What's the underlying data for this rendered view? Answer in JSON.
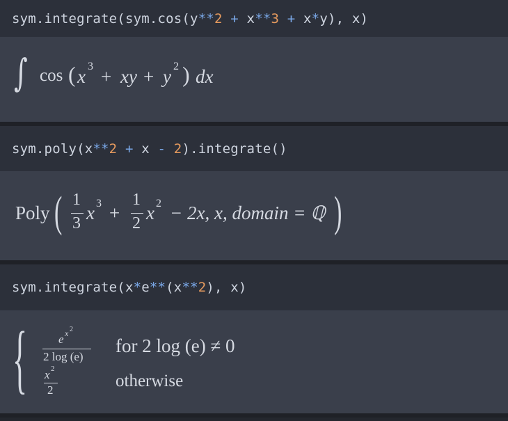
{
  "cells": [
    {
      "code": {
        "prefix": "sym.integrate(sym.cos(y",
        "op1": "**",
        "n1": "2",
        "sp1": " ",
        "plus1": "+",
        "mid1": " x",
        "op2": "**",
        "n2": "3",
        "sp2": " ",
        "plus2": "+",
        "mid2": " x",
        "op3": "*",
        "suffix": "y), x)"
      },
      "output": {
        "integral": "∫",
        "cos": "cos",
        "lparen": "(",
        "x": "x",
        "exp3": "3",
        "plus_a": "+",
        "xy": "xy",
        "plus_b": "+",
        "y": "y",
        "exp2": "2",
        "rparen": ")",
        "dx": "dx"
      }
    },
    {
      "code": {
        "prefix": "sym.poly(x",
        "op1": "**",
        "n1": "2",
        "sp1": " ",
        "plus1": "+",
        "mid1": " x ",
        "minus": "-",
        "sp2": " ",
        "n2": "2",
        "suffix": ").integrate()"
      },
      "output": {
        "poly": "Poly",
        "lparen": "(",
        "num1": "1",
        "den1": "3",
        "x1": "x",
        "exp1": "3",
        "plus": "+",
        "num2": "1",
        "den2": "2",
        "x2": "x",
        "exp2": "2",
        "rest": "− 2x, x, domain = ℚ",
        "rparen": ")"
      }
    },
    {
      "code": {
        "prefix": "sym.integrate(x",
        "op1": "*",
        "mid1": "e",
        "op2": "**",
        "mid2": "(x",
        "op3": "**",
        "n1": "2",
        "suffix": "), x)"
      },
      "output": {
        "brace": "{",
        "num1_base": "e",
        "num1_exp": "x",
        "num1_exp2": "2",
        "den1": "2 log (e)",
        "num2_base": "x",
        "num2_exp": "2",
        "den2": "2",
        "cond1": "for 2 log (e) ≠ 0",
        "cond2": "otherwise"
      }
    }
  ]
}
